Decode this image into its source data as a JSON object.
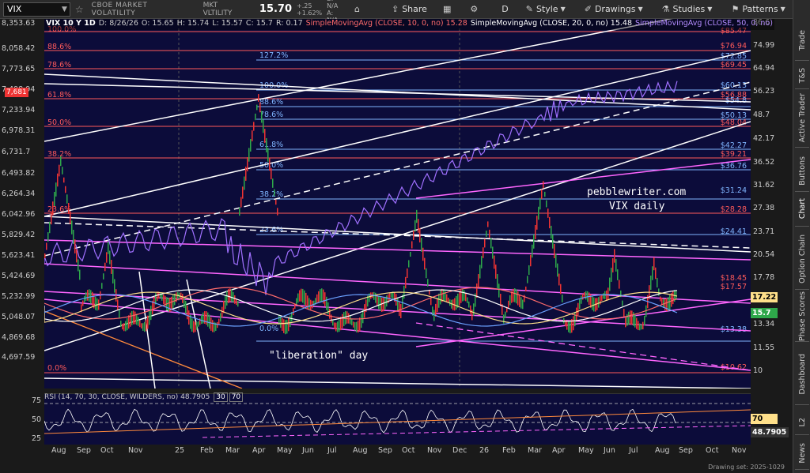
{
  "toolbar": {
    "symbol": "VIX",
    "name": "CBOE MARKET VOLATILITY",
    "name2": "MKT VLTILITY",
    "last": "15.70",
    "chg1": "+.25",
    "chg2": "+1.62%",
    "bid": "B: N/A",
    "ask": "A: N/A",
    "share_label": "Share",
    "period_label": "D",
    "style_label": "Style",
    "drawings_label": "Drawings",
    "studies_label": "Studies",
    "patterns_label": "Patterns"
  },
  "info": {
    "sym": "VIX 10 Y 1D",
    "date": "D: 8/26/26",
    "o": "O: 15.65",
    "h": "H: 15.74",
    "l": "L: 15.57",
    "c": "C: 15.7",
    "r": "R: 0.17",
    "sma10": "SimpleMovingAvg (CLOSE, 10, 0, no) 15.28",
    "sma20": "SimpleMovingAvg (CLOSE, 20, 0, no) 15.48",
    "sma50": "SimpleMovingAvg (CLOSE, 50, 0, no)"
  },
  "left_axis": {
    "labels": [
      "8,353.63",
      "8,058.42",
      "7,773.65",
      "7,498.94",
      "7,233.94",
      "6,978.31",
      "6,731.7",
      "6,493.82",
      "6,264.34",
      "6,042.96",
      "5,829.42",
      "5,623.41",
      "5,424.69",
      "5,232.99",
      "5,048.07",
      "4,869.68",
      "4,697.59"
    ],
    "price_tag": "7,681"
  },
  "right_axis": {
    "labels": [
      "86.6",
      "74.99",
      "64.94",
      "56.23",
      "48.7",
      "42.17",
      "36.52",
      "31.62",
      "27.38",
      "23.71",
      "20.54",
      "17.78",
      "15.4",
      "13.34",
      "11.55",
      "10"
    ],
    "sma_tag": "17.22",
    "price_tag": "15.7"
  },
  "fib_left": [
    "100.0%",
    "88.6%",
    "78.6%",
    "61.8%",
    "50.0%",
    "38.2%",
    "23.6%",
    "0.0%"
  ],
  "fib_mid": [
    "127.2%",
    "100.0%",
    "88.6%",
    "78.6%",
    "61.8%",
    "50.0%",
    "38.2%",
    "23.6%",
    "0.0%"
  ],
  "fib_right": [
    "$85.47",
    "$76.94",
    "$72.85",
    "$69.45",
    "$60.13",
    "$56.88",
    "$54.8",
    "$50.13",
    "$48.04",
    "$42.27",
    "$39.21",
    "$36.76",
    "$31.24",
    "$28.28",
    "$24.41",
    "$18.45",
    "$17.57",
    "$13.38",
    "$10.62"
  ],
  "annotations": {
    "site": "pebblewriter.com",
    "sub": "VIX daily",
    "event": "\"liberation\" day"
  },
  "rsi": {
    "label": "RSI (14, 70, 30, CLOSE, WILDERS, no) 48.7905",
    "ob": "30",
    "os": "70",
    "left_labels": [
      "75",
      "50",
      "25"
    ],
    "tag70": "70",
    "tag_val": "48.7905"
  },
  "timeline": [
    "Aug",
    "Sep",
    "Oct",
    "Nov",
    "25",
    "Feb",
    "Mar",
    "Apr",
    "May",
    "Jun",
    "Jul",
    "Aug",
    "Sep",
    "Oct",
    "Nov",
    "Dec",
    "26",
    "Feb",
    "Mar",
    "Apr",
    "May",
    "Jun",
    "Jul",
    "Aug",
    "Sep",
    "Oct",
    "Nov"
  ],
  "statusbar": {
    "text": "Drawing set: 2025-1029"
  },
  "right_tabs": [
    "Trade",
    "T&S",
    "Active Trader",
    "Buttons",
    "Chart",
    "Option Chain",
    "Phase Scores",
    "Dashboard",
    "L2",
    "News"
  ],
  "colors": {
    "bg": "#0c0c3a",
    "fib_red": "#ff5a5a",
    "fib_blue": "#7fb5ff",
    "magenta": "#ff66ff",
    "sma_purple": "#a070ff"
  }
}
